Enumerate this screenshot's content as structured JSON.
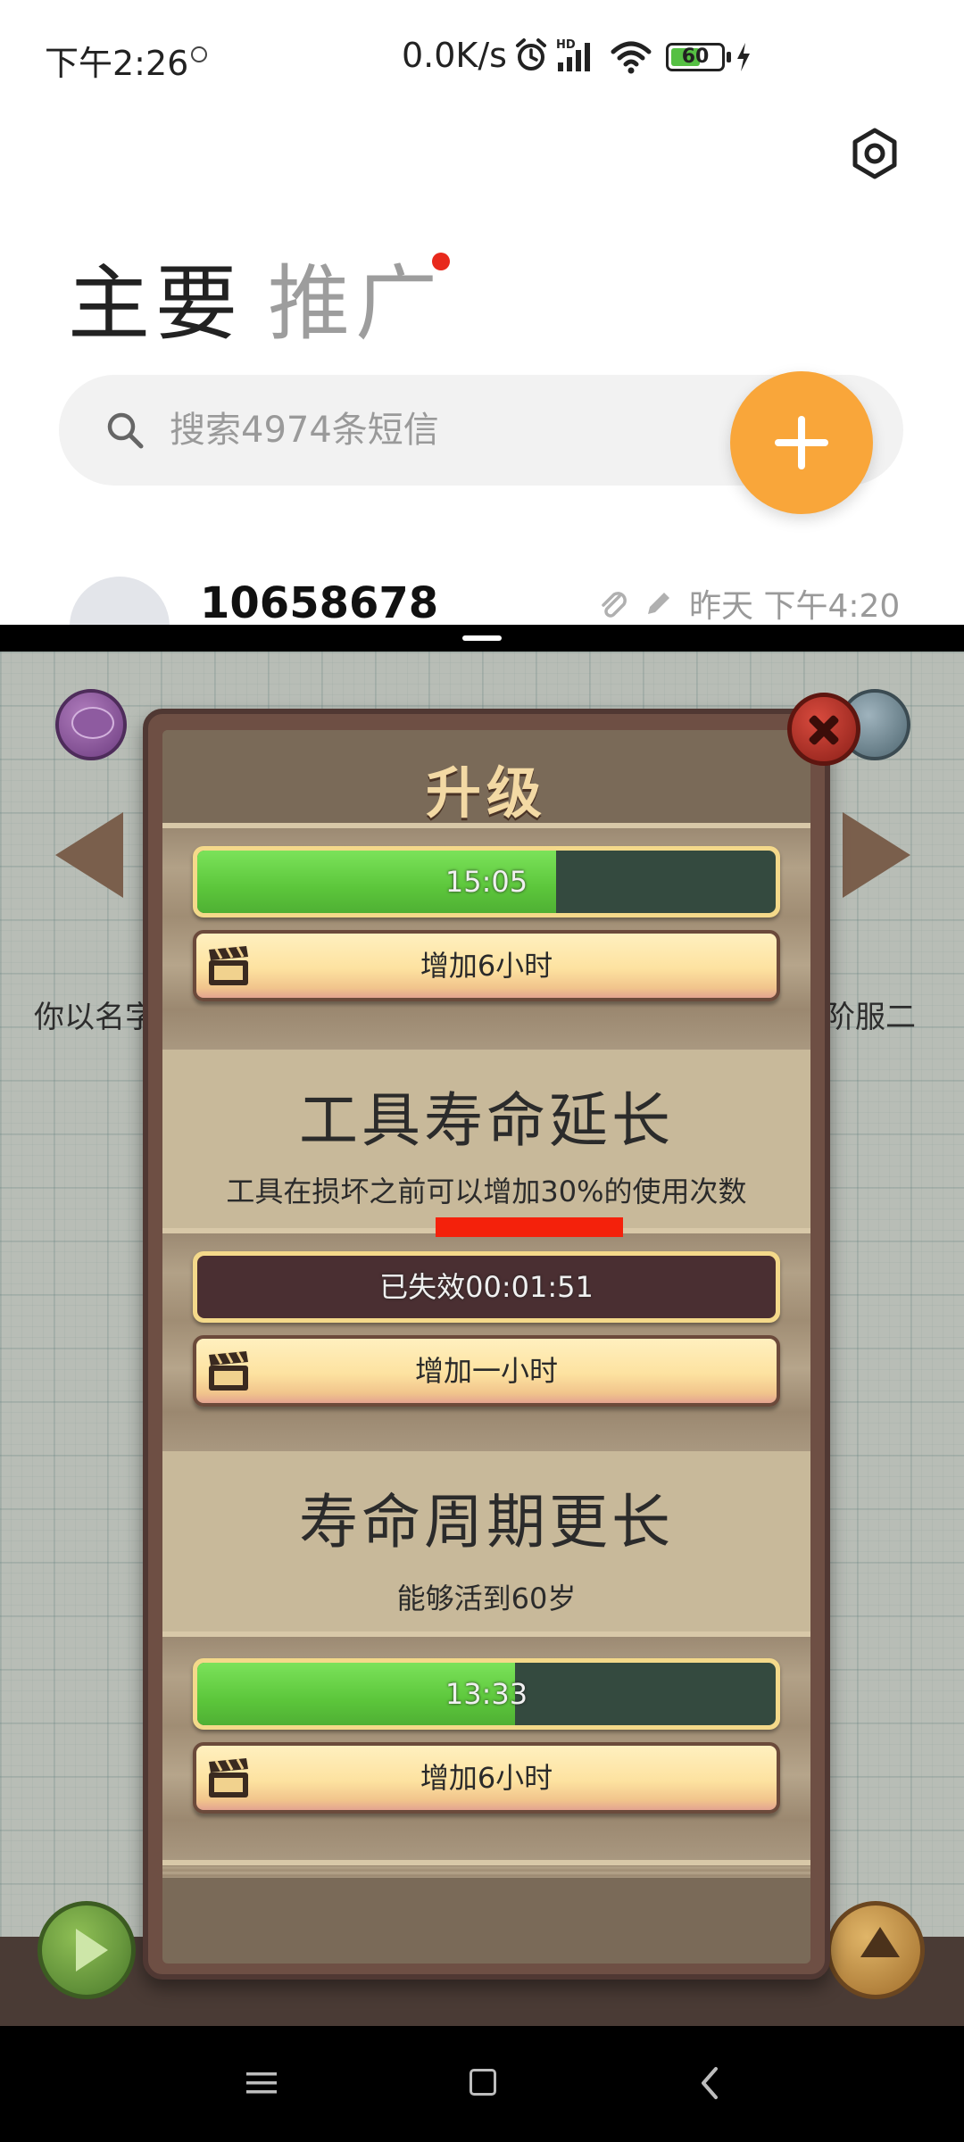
{
  "status_bar": {
    "time": "下午2:26",
    "net_speed": "0.0K/s",
    "battery_level": "60",
    "icons": [
      "alarm-icon",
      "hd-signal-icon",
      "wifi-icon",
      "battery-icon",
      "charging-icon"
    ]
  },
  "messages_app": {
    "tabs": [
      {
        "label": "主要",
        "active": true
      },
      {
        "label": "推广",
        "active": false,
        "has_unread_dot": true
      }
    ],
    "search": {
      "placeholder": "搜索4974条短信"
    },
    "fab_icon": "plus-icon",
    "conversation": {
      "sender": "10658678",
      "time": "昨天 下午4:20"
    }
  },
  "game": {
    "side_text_left": "你以名字",
    "side_text_right": "阶服二",
    "modal": {
      "title": "升级",
      "sections": [
        {
          "timer": "15:05",
          "progress": 0.62,
          "button_label": "增加6小时"
        },
        {
          "title": "工具寿命延长",
          "description": "工具在损坏之前可以增加30%的使用次数",
          "timer": "已失效00:01:51",
          "expired": true,
          "button_label": "增加一小时"
        },
        {
          "title": "寿命周期更长",
          "description": "能够活到60岁",
          "timer": "13:33",
          "progress": 0.55,
          "button_label": "增加6小时"
        }
      ]
    }
  },
  "colors": {
    "fab": "#f9a63a",
    "unread_dot": "#e8291c",
    "progress_green": "#5cc63b",
    "highlight_underline": "#f4210b"
  }
}
